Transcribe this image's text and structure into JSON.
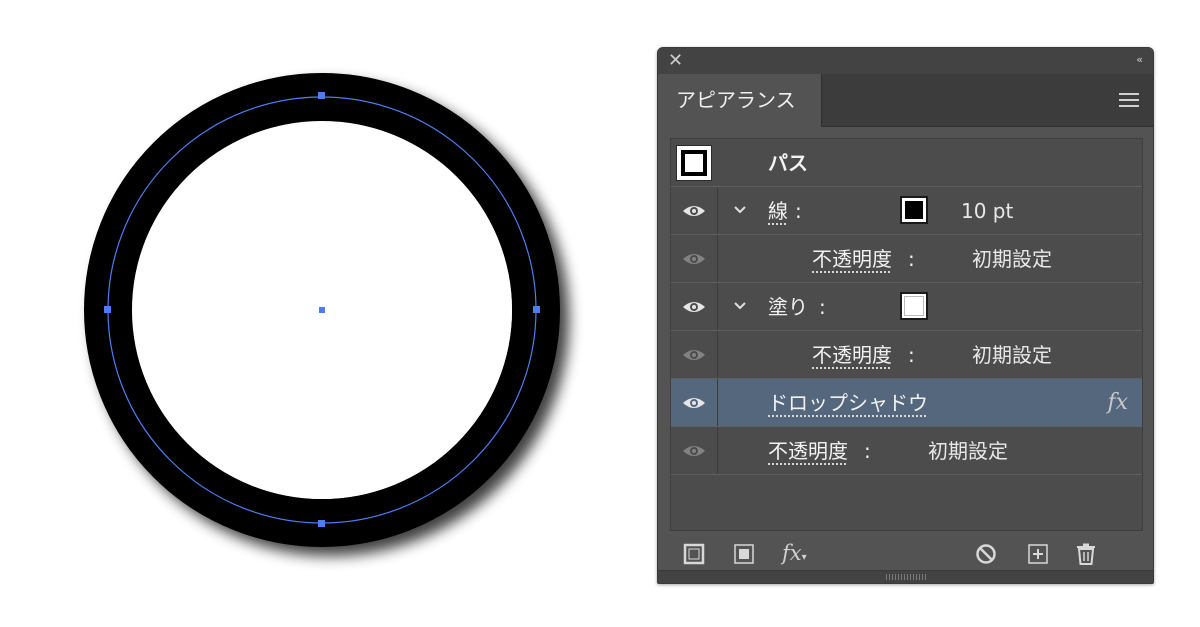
{
  "panel": {
    "close_glyph": "✕",
    "collapse_glyph": "‹‹",
    "tab_label": "アピアランス",
    "menu_icon": "hamburger-menu-icon"
  },
  "rows": {
    "path": {
      "label": "パス",
      "thumbnail_icon": "path-thumbnail-icon"
    },
    "stroke": {
      "label": "線",
      "colon": ":",
      "swatch_color": "#000000",
      "value": "10 pt"
    },
    "stroke_opacity": {
      "label": "不透明度",
      "colon": ":",
      "value": "初期設定"
    },
    "fill": {
      "label": "塗り",
      "colon": ":",
      "swatch_color": "#ffffff"
    },
    "fill_opacity": {
      "label": "不透明度",
      "colon": ":",
      "value": "初期設定"
    },
    "drop_shadow": {
      "label": "ドロップシャドウ",
      "fx_glyph": "fx"
    },
    "opacity": {
      "label": "不透明度",
      "colon": ":",
      "value": "初期設定"
    }
  },
  "footer": {
    "icons": [
      "add-stroke-icon",
      "add-fill-icon",
      "add-effect-icon",
      "clear-appearance-icon",
      "duplicate-item-icon",
      "delete-item-icon"
    ],
    "fx_label": "fx"
  },
  "colors": {
    "panel_bg": "#535353",
    "selection": "#55677d",
    "path_selection": "#4f7cf0"
  }
}
